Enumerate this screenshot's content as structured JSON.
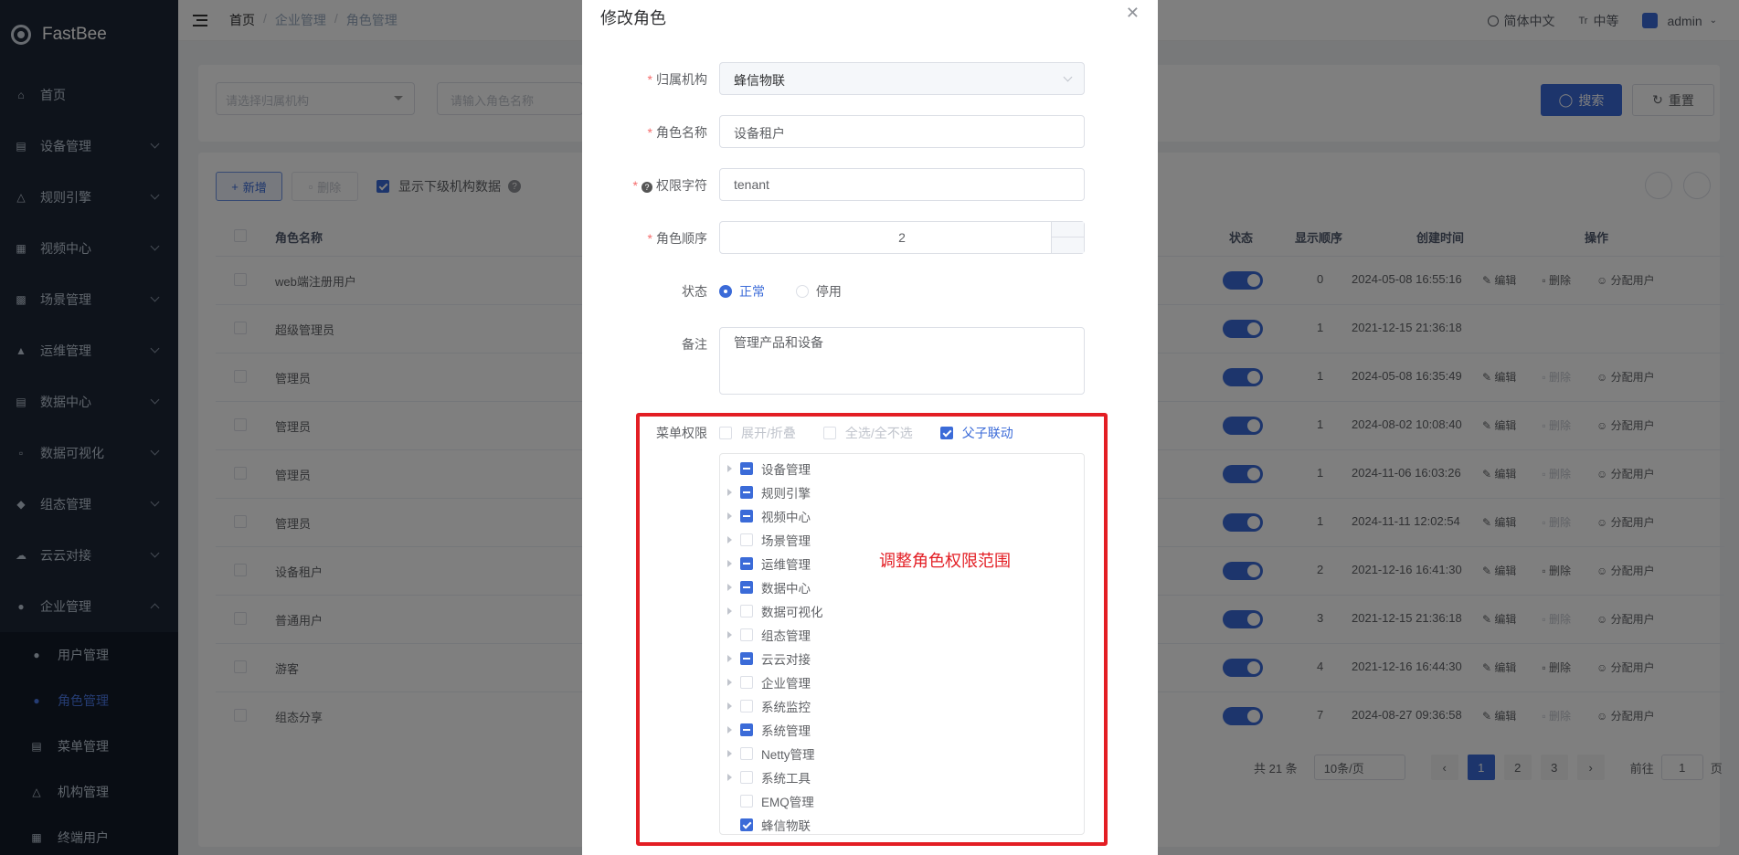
{
  "app": {
    "logo_text": "FastBee"
  },
  "sidebar": {
    "items": [
      {
        "label": "首页",
        "icon": "home-icon"
      },
      {
        "label": "设备管理",
        "icon": "device-icon"
      },
      {
        "label": "规则引擎",
        "icon": "rule-icon"
      },
      {
        "label": "视频中心",
        "icon": "video-icon"
      },
      {
        "label": "场景管理",
        "icon": "scene-icon"
      },
      {
        "label": "运维管理",
        "icon": "ops-icon"
      },
      {
        "label": "数据中心",
        "icon": "data-icon"
      },
      {
        "label": "数据可视化",
        "icon": "visual-icon"
      },
      {
        "label": "组态管理",
        "icon": "config-icon"
      },
      {
        "label": "云云对接",
        "icon": "cloud-icon"
      },
      {
        "label": "企业管理",
        "icon": "enterprise-icon"
      }
    ],
    "sub_items": [
      {
        "label": "用户管理"
      },
      {
        "label": "角色管理"
      },
      {
        "label": "菜单管理"
      },
      {
        "label": "机构管理"
      },
      {
        "label": "终端用户"
      }
    ]
  },
  "header": {
    "breadcrumb": [
      "首页",
      "企业管理",
      "角色管理"
    ],
    "lang": "简体中文",
    "size": "中等",
    "user": "admin"
  },
  "search": {
    "org_placeholder": "请选择归属机构",
    "name_placeholder": "请输入角色名称",
    "search_label": "搜索",
    "reset_label": "重置"
  },
  "toolbar": {
    "add_label": "新增",
    "delete_label": "删除",
    "show_sub_label": "显示下级机构数据"
  },
  "table": {
    "headers": {
      "name": "角色名称",
      "status": "状态",
      "order": "显示顺序",
      "created": "创建时间",
      "ops": "操作"
    },
    "ops_labels": {
      "edit": "编辑",
      "delete": "删除",
      "assign": "分配用户"
    },
    "rows": [
      {
        "name": "web端注册用户",
        "order": "0",
        "created": "2024-05-08 16:55:16",
        "ops": "full"
      },
      {
        "name": "超级管理员",
        "order": "1",
        "created": "2021-12-15 21:36:18",
        "ops": "none"
      },
      {
        "name": "管理员",
        "order": "1",
        "created": "2024-05-08 16:35:49",
        "ops": "disabled"
      },
      {
        "name": "管理员",
        "order": "1",
        "created": "2024-08-02 10:08:40",
        "ops": "disabled"
      },
      {
        "name": "管理员",
        "order": "1",
        "created": "2024-11-06 16:03:26",
        "ops": "disabled"
      },
      {
        "name": "管理员",
        "order": "1",
        "created": "2024-11-11 12:02:54",
        "ops": "disabled"
      },
      {
        "name": "设备租户",
        "order": "2",
        "created": "2021-12-16 16:41:30",
        "ops": "full"
      },
      {
        "name": "普通用户",
        "order": "3",
        "created": "2021-12-15 21:36:18",
        "ops": "disabled"
      },
      {
        "name": "游客",
        "order": "4",
        "created": "2021-12-16 16:44:30",
        "ops": "full"
      },
      {
        "name": "组态分享",
        "order": "7",
        "created": "2024-08-27 09:36:58",
        "ops": "disabled"
      }
    ]
  },
  "pagination": {
    "total": "共 21 条",
    "page_size": "10条/页",
    "pages": [
      "1",
      "2",
      "3"
    ],
    "goto": "前往",
    "goto_value": "1",
    "page_suffix": "页"
  },
  "dialog": {
    "title": "修改角色",
    "org_label": "归属机构",
    "org_value": "蜂信物联",
    "name_label": "角色名称",
    "name_value": "设备租户",
    "key_label": "权限字符",
    "key_value": "tenant",
    "order_label": "角色顺序",
    "order_value": "2",
    "status_label": "状态",
    "status_normal": "正常",
    "status_disabled": "停用",
    "remark_label": "备注",
    "remark_value": "管理产品和设备",
    "menu_label": "菜单权限",
    "expand_label": "展开/折叠",
    "select_all_label": "全选/全不选",
    "linkage_label": "父子联动",
    "tree": [
      {
        "label": "设备管理",
        "state": "half",
        "caret": true
      },
      {
        "label": "规则引擎",
        "state": "half",
        "caret": true
      },
      {
        "label": "视频中心",
        "state": "half",
        "caret": true
      },
      {
        "label": "场景管理",
        "state": "off",
        "caret": true
      },
      {
        "label": "运维管理",
        "state": "half",
        "caret": true
      },
      {
        "label": "数据中心",
        "state": "half",
        "caret": true
      },
      {
        "label": "数据可视化",
        "state": "off",
        "caret": true
      },
      {
        "label": "组态管理",
        "state": "off",
        "caret": true
      },
      {
        "label": "云云对接",
        "state": "half",
        "caret": true
      },
      {
        "label": "企业管理",
        "state": "off",
        "caret": true
      },
      {
        "label": "系统监控",
        "state": "off",
        "caret": true
      },
      {
        "label": "系统管理",
        "state": "half",
        "caret": true
      },
      {
        "label": "Netty管理",
        "state": "off",
        "caret": true
      },
      {
        "label": "系统工具",
        "state": "off",
        "caret": true
      },
      {
        "label": "EMQ管理",
        "state": "off",
        "caret": false
      },
      {
        "label": "蜂信物联",
        "state": "on",
        "caret": false
      }
    ],
    "annotation": "调整角色权限范围"
  },
  "colors": {
    "primary": "#3b6bd8",
    "sidebar_bg": "#1d2636",
    "annotation": "#e31e24"
  }
}
